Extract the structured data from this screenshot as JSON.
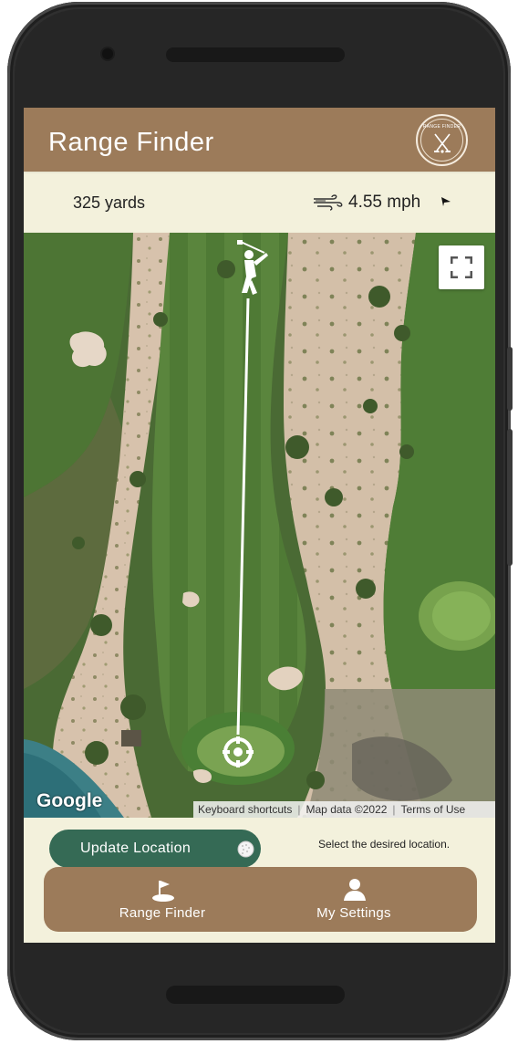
{
  "header": {
    "title": "Range Finder",
    "logo_text": "RANGE FINDER"
  },
  "info": {
    "distance": "325 yards",
    "wind_speed": "4.55 mph",
    "wind_icon": "wind-icon",
    "wind_direction_icon": "arrow-direction-icon"
  },
  "map": {
    "google_logo": "Google",
    "attribution": {
      "shortcuts": "Keyboard shortcuts",
      "map_data": "Map data ©2022",
      "terms": "Terms of Use"
    },
    "fullscreen_icon": "fullscreen-icon",
    "golfer_icon": "golfer-icon",
    "target_icon": "target-icon"
  },
  "actions": {
    "update_location_label": "Update Location",
    "hint": "Select the desired location."
  },
  "nav": {
    "items": [
      {
        "label": "Range Finder",
        "icon": "flag-icon"
      },
      {
        "label": "My Settings",
        "icon": "user-icon"
      }
    ]
  },
  "colors": {
    "header": "#9c7b5a",
    "background": "#f3f1dc",
    "update_button": "#356a55",
    "nav": "#9c7b5a"
  }
}
